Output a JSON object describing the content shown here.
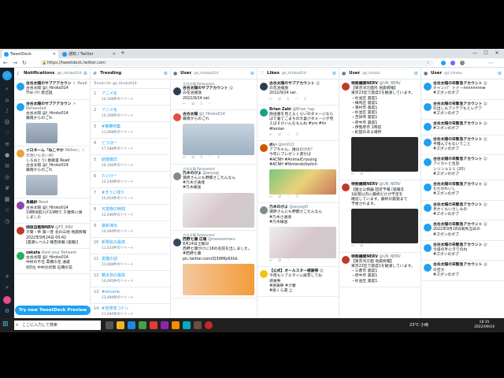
{
  "browser": {
    "tabs": [
      {
        "label": "TweetDeck",
        "active": true
      },
      {
        "label": "通知 / Twitter",
        "active": false
      }
    ],
    "new_tab": "+",
    "url": "https://tweetdeck.twitter.com",
    "controls": {
      "min": "—",
      "max": "☐",
      "close": "✕"
    }
  },
  "sidebar": {
    "logo": "🐦",
    "icons": [
      "search-icon",
      "home-icon",
      "bell-icon",
      "at-icon",
      "heart-icon",
      "list-icon",
      "person-icon",
      "mail-icon",
      "compass-icon",
      "hash-icon",
      "calendar-icon",
      "star-icon",
      "clock-icon",
      "gear-icon"
    ]
  },
  "columns": {
    "notifications": {
      "title": "Notifications",
      "handle": "@I_Hiroko014",
      "items": [
        {
          "name": "古谷太陽のサブアアカウン",
          "handle": "ト Read",
          "text": "古谷太陽 @I_Hiroko014\nThe ｲﾔﾗ 思出過",
          "media": false
        },
        {
          "name": "古谷太陽のサブアアカウン",
          "handle": "ト Retweeted",
          "text": "古谷太陽 @I_Hiroko014\n霧雨からのこれ",
          "media": true
        },
        {
          "name": "イロネーム「ねこやか",
          "handle": "Walker」 \\ 年明けも赤い柄!",
          "text": "しろおとう) 春藤里 Read\n古谷太陽 @I_Hiroko014\n霧雨からのこれ",
          "media": true
        },
        {
          "name": "長嶋鈴",
          "handle": "Read",
          "text": "古谷太陽 @I_Hiroko014\n19時頃前川川19時で 千葉県に帰\nしました",
          "media": false
        },
        {
          "name": "姉保自衛隊NRV",
          "handle": "@FS_NRV",
          "text": "千葉・県 第一巻 北の山地 地震情報 2022年9月24日 00:42\n[震源レベル2 報告情報 (速報)]",
          "media": false
        },
        {
          "name": "zakata",
          "handle": "liked your Retweet",
          "text": "古谷太陽 @I_Hiroko014\n中村の不在 高橋の花 通運\n到3位 中村の状態 石橋の花",
          "media": false
        }
      ],
      "preview_button": "Try new TweetDeck Preview"
    },
    "trending": {
      "title": "Trending",
      "subtitle": "Trends for @I_Hiroko014",
      "items": [
        {
          "num": "1",
          "name": "アニメ化",
          "count": "10,108件のツイート"
        },
        {
          "num": "2",
          "name": "アニメ化",
          "count": "10,108件のツイート"
        },
        {
          "num": "3",
          "name": "#推薦特集",
          "count": "11,008件のツイート"
        },
        {
          "num": "4",
          "name": "どうほー",
          "count": "17,588件のツイート"
        },
        {
          "num": "5",
          "name": "結婚儀式",
          "count": "10,194件のツイート"
        },
        {
          "num": "6",
          "name": "たいけー",
          "count": "12,149件のツイート"
        },
        {
          "num": "7",
          "name": "#きうに残り",
          "count": "10,054件のツイート"
        },
        {
          "num": "8",
          "name": "可愛物の時間",
          "count": "12,046件のツイート"
        },
        {
          "num": "9",
          "name": "最新演出",
          "count": "10,094件のツイート"
        },
        {
          "num": "10",
          "name": "新規名の最高",
          "count": "11,024件のツイート"
        },
        {
          "num": "11",
          "name": "黒猫の話",
          "count": "13,468件のツイート"
        },
        {
          "num": "12",
          "name": "勝太自の最高",
          "count": "14,095件のツイート"
        },
        {
          "num": "13",
          "name": "#ohvarla",
          "count": "13,094件のツイート"
        },
        {
          "num": "14",
          "name": "#自排泄コナン",
          "count": "11,094件のツイート"
        }
      ]
    },
    "user1": {
      "title": "User",
      "handle": "@I_Hiroko014",
      "items": [
        {
          "rt": "古谷太陽 Retweeted",
          "name": "古谷太陽のサブアカウント",
          "handle": "@",
          "text": "の花池播放\n2022/9/24 sat.",
          "media": false,
          "acts": "↩ ⇄ 1 ♡"
        },
        {
          "rt": "",
          "name": "古谷太陽",
          "handle": "@I_Hiroko014",
          "text": "霧雨からのこれ",
          "media": true,
          "acts": "↩ ⇄ 1 ♡ 1"
        },
        {
          "rt": "古谷太陽 Retweeted",
          "name": "乃木のがよ",
          "handle": "@aoyagi",
          "text": "蒲原さんにも野都さこたんなん\n#乃木さ通達\n#乃木様送",
          "media": true,
          "acts": "↩ ⇄ 1 ♡"
        },
        {
          "rt": "古谷太陽 Retweeted",
          "name": "西野七瀬 広報",
          "handle": "@nanasemaru",
          "text": "8月24日土曜日\n西野七瀬がけに16の名前を出しました。\n#西野七瀬\npic.twitter.com/IQ3WMp6Xkb",
          "media": true,
          "acts": ""
        }
      ]
    },
    "likes": {
      "title": "Likes",
      "handle": "@I_Hiroko014",
      "items": [
        {
          "name": "古谷太陽のサブアカウント",
          "handle": "@",
          "text": "の花池播放\n2022/9/24 sat.",
          "media": false,
          "acts": "↩ ⇄ 1 ♡ 1"
        },
        {
          "name": "Brian Zabi",
          "handle": "@Brian_tag",
          "text": "放送塞を見えるくらいのダメージならばで着てこまちの大喜びダメージが見えばそけいんなもんね #yro #iin\n#tenlan",
          "media": false,
          "acts": "↩ ⇄ ♡ 1"
        },
        {
          "name": "めい",
          "handle": "@sin022",
          "text": "アプちゃん、誰ほだけだ！\n今年にプレゼント渡せば\n#ACNH #AnimalCrossing\n#ACNH #NintendoSwitch",
          "media": true,
          "acts": "↩ ⇄ ♡ 1"
        },
        {
          "name": "乃木のがよ",
          "handle": "@aoyagi0",
          "text": "蒲原さんにも野都さこたんなん\n#乃木さ通達\n#乃木様送",
          "media": true,
          "acts": "↩ ⇄ ♡"
        },
        {
          "name": "【公式】オールスター感謝祭",
          "handle": "@",
          "text": "今夜もリアルタイム投票してね\n感謝祭\n#感謝祭 #グ番\n#投くら運 上",
          "media": false,
          "acts": ""
        }
      ]
    },
    "user2": {
      "title": "User",
      "handle": "@I_Hiroko",
      "items": [
        {
          "name": "特務機関NERV",
          "handle": "@UN_NERV",
          "text": "【東京湾方面内 地震情報】\n東京23区で震度1を観測しています。\n・杉並区 震度1\n・練馬区 震度1\n・東村市 震度1\n・杉並区 震度1\n・吉祥寺 震度1\n・府中市 震度1\n・伊勢原市 1時前\n・町田のある場所",
          "media": true,
          "acts": "↩ ⇄ ♡"
        },
        {
          "name": "特務機関NERV",
          "handle": "@UN_NERV",
          "text": "【国立公務器 固定予報 (速報)】\n1段階以内に最終だけが予定を\n確認しています。最終の震発まで\n予想されます。",
          "media": true,
          "acts": "↩ ⇄ ♡"
        },
        {
          "name": "特務機関NERV",
          "handle": "@UN_NERV",
          "text": "【東京湾方面 地震情報】\n東京23区で震度1を観測しています。\n・三鷹市 震度1\n・府中市 震度1\n・杉並区 震度1",
          "media": false,
          "acts": ""
        }
      ]
    },
    "user3": {
      "title": "User",
      "handle": "@I_Hiroko",
      "items": [
        {
          "name": "古谷太陽の宋緊急アカウント",
          "handle": "@",
          "text": "チャンバ゜ドドーnnnnnnnnw\n#ズボンのボブ",
          "media": false
        },
        {
          "name": "古谷太陽の宋緊急アカウント",
          "handle": "@",
          "text": "引出しもアイデアもとレデア\n#ズボンのボブ",
          "media": false
        },
        {
          "name": "古谷太陽の宋緊急アカウント",
          "handle": "@",
          "text": "#スボンのボブ",
          "media": false
        },
        {
          "name": "古谷太陽の宋緊急アカウント",
          "handle": "@",
          "text": "手積んでもないでこと\n#ズボンのボブ",
          "media": false
        },
        {
          "name": "古谷太陽の宋緊急アカウント",
          "handle": "@",
          "text": "アイカトと生息\nシリンユミミ (20)\n#ズボンのボブ",
          "media": false
        },
        {
          "name": "古谷太陽の宋緊急アカウント",
          "handle": "@",
          "text": "ただわれいし\n#ズボンのボブ",
          "media": false
        },
        {
          "name": "古谷太陽の宋緊急アカウント",
          "handle": "@",
          "text": "手かくもいさしもの\n#ズボンのボブ",
          "media": false
        },
        {
          "name": "古谷太陽の宋緊急アカウント",
          "handle": "@",
          "text": "2022年9月18日競馬当日の\n#ズボンのボブ",
          "media": false
        },
        {
          "name": "古谷太陽の宋緊急アカウント",
          "handle": "@",
          "text": "今道の手にタでのね\n#ズボンのボブ",
          "media": false
        },
        {
          "name": "古谷太陽の宋緊急アカウント",
          "handle": "@",
          "text": "の空大\n#ズボンのボブ",
          "media": false
        }
      ]
    }
  },
  "taskbar": {
    "search_placeholder": "ここに入力して検索",
    "weather": "23°C 小雨",
    "time": "18:35",
    "date": "2022/09/24"
  },
  "colors": {
    "accent": "#1da1f2",
    "sidebar": "#15202b",
    "taskbar": "#202020"
  }
}
